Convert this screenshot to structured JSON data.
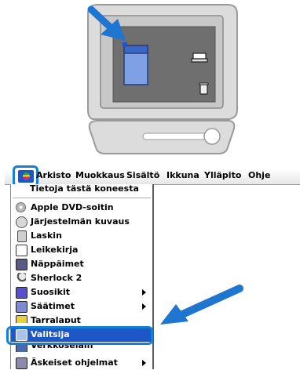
{
  "menubar": {
    "items": [
      "Arkisto",
      "Muokkaus",
      "Sisältö",
      "Ikkuna",
      "Ylläpito",
      "Ohje"
    ]
  },
  "menu": {
    "header": "Tietoja tästä koneesta",
    "items": [
      {
        "label": "Apple DVD-soitin",
        "icon": "dvd-icon",
        "submenu": false
      },
      {
        "label": "Järjestelmän kuvaus",
        "icon": "system-profiler-icon",
        "submenu": false
      },
      {
        "label": "Laskin",
        "icon": "calculator-icon",
        "submenu": false
      },
      {
        "label": "Leikekirja",
        "icon": "scrapbook-icon",
        "submenu": false
      },
      {
        "label": "Näppäimet",
        "icon": "key-caps-icon",
        "submenu": false
      },
      {
        "label": "Sherlock 2",
        "icon": "sherlock-icon",
        "submenu": false
      },
      {
        "label": "Suosikit",
        "icon": "favorites-icon",
        "submenu": true
      },
      {
        "label": "Säätimet",
        "icon": "control-panels-icon",
        "submenu": true
      },
      {
        "label": "Tarralaput",
        "icon": "stickies-icon",
        "submenu": false
      },
      {
        "label": "Valitsija",
        "icon": "chooser-icon",
        "submenu": false,
        "selected": true
      },
      {
        "label": "Verkkoselain",
        "icon": "browser-icon",
        "submenu": false
      },
      {
        "label": "Äskeiset ohjelmat",
        "icon": "recent-apps-icon",
        "submenu": true
      }
    ]
  },
  "colors": {
    "highlight": "#1480d8",
    "selection": "#1c56c7"
  }
}
